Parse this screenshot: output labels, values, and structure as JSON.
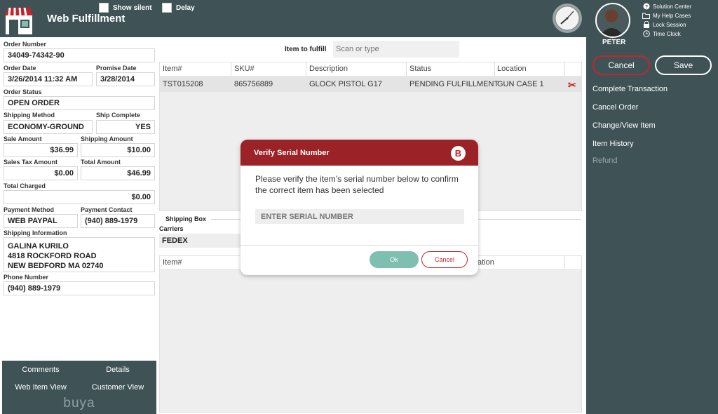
{
  "header": {
    "title": "Web Fulfillment",
    "show_silent_label": "Show silent",
    "delay_label": "Delay"
  },
  "user": {
    "name": "PETER",
    "links": [
      "Solution Center",
      "My Help Cases",
      "Lock Session",
      "Time Clock"
    ]
  },
  "actions": {
    "cancel_label": "Cancel",
    "save_label": "Save",
    "items": [
      "Complete Transaction",
      "Cancel Order",
      "Change/View Item",
      "Item History",
      "Refund"
    ]
  },
  "order": {
    "order_number_label": "Order Number",
    "order_number": "34049-74342-90",
    "order_date_label": "Order Date",
    "order_date": "3/26/2014 11:32 AM",
    "promise_date_label": "Promise Date",
    "promise_date": "3/28/2014",
    "status_label": "Order Status",
    "status": "OPEN ORDER",
    "shipping_method_label": "Shipping Method",
    "shipping_method": "ECONOMY-GROUND",
    "ship_complete_label": "Ship Complete",
    "ship_complete": "YES",
    "sale_amount_label": "Sale Amount",
    "sale_amount": "$36.99",
    "shipping_amount_label": "Shipping Amount",
    "shipping_amount": "$10.00",
    "sales_tax_label": "Sales Tax Amount",
    "sales_tax": "$0.00",
    "total_amount_label": "Total Amount",
    "total_amount": "$46.99",
    "total_charged_label": "Total Charged",
    "total_charged": "$0.00",
    "payment_method_label": "Payment Method",
    "payment_method": "WEB PAYPAL",
    "payment_contact_label": "Payment Contact",
    "payment_contact": "(940) 889-1979",
    "shipping_info_label": "Shipping Information",
    "shipping_info": [
      "GALINA KURILO",
      "4818 ROCKFORD ROAD",
      "NEW BEDFORD MA 02740"
    ],
    "phone_label": "Phone Number",
    "phone": "(940) 889-1979"
  },
  "left_buttons": {
    "comments": "Comments",
    "details": "Details",
    "web_item_view": "Web Item View",
    "customer_view": "Customer View",
    "brand": "buya"
  },
  "fulfill": {
    "label": "Item to fulfill",
    "placeholder": "Scan or type"
  },
  "items_table": {
    "columns": [
      "Item#",
      "SKU#",
      "Description",
      "Status",
      "Location"
    ],
    "rows": [
      [
        "TST015208",
        "865756889",
        "GLOCK PISTOL G17",
        "PENDING FULFILLMENT",
        "GUN CASE 1"
      ]
    ]
  },
  "shipping_box": {
    "label": "Shipping Box",
    "carriers_label": "Carriers",
    "carrier": "FEDEX",
    "col_item": "Item#",
    "col_location_partial": "ation"
  },
  "modal": {
    "title": "Verify Serial Number",
    "badge": "B",
    "message": "Please verify the item’s serial number below to confirm the correct item has been selected",
    "serial_placeholder": "ENTER SERIAL NUMBER",
    "ok_label": "Ok",
    "cancel_label": "Cancel"
  }
}
